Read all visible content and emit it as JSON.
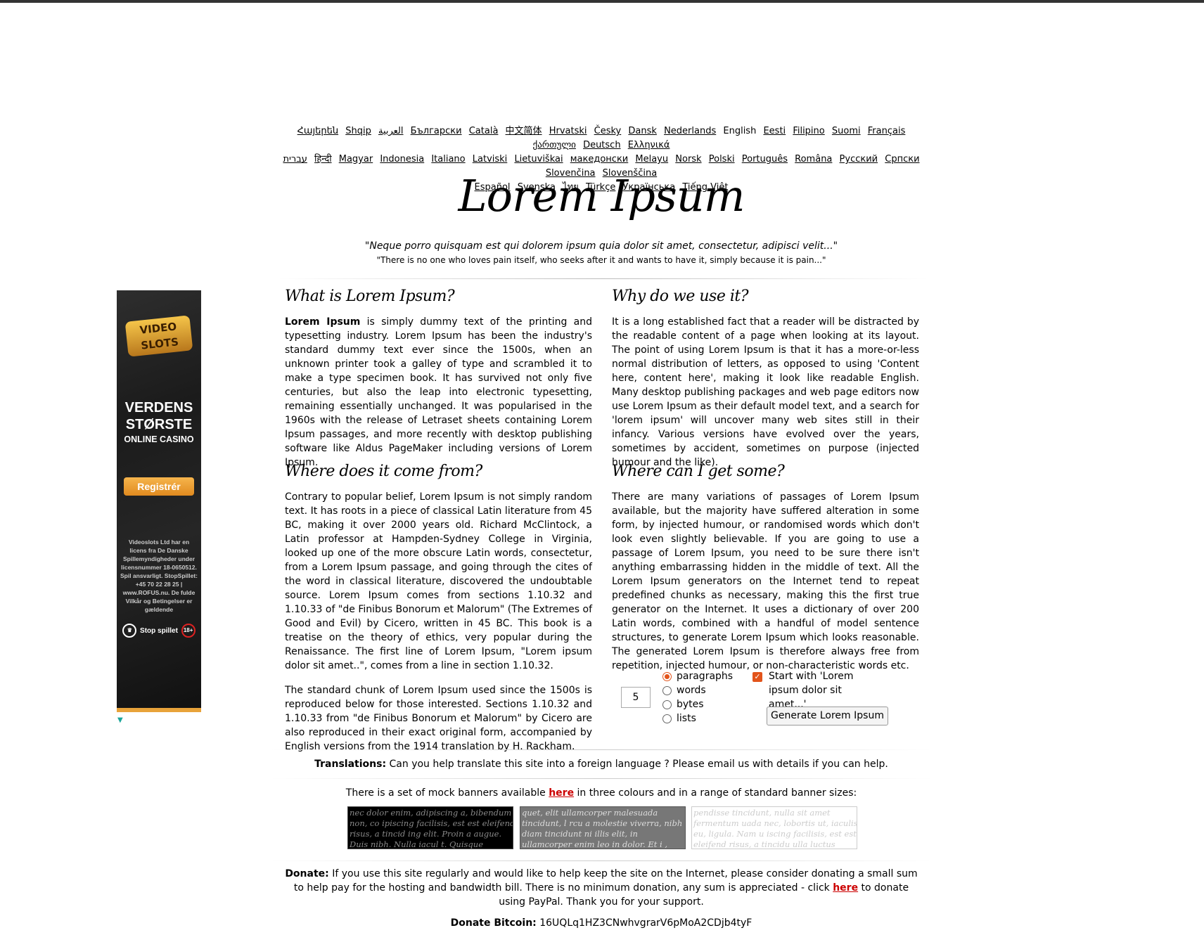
{
  "languages": {
    "row1": [
      "Հայերեն",
      "Shqip",
      "العربية",
      "Български",
      "Català",
      "中文简体",
      "Hrvatski",
      "Česky",
      "Dansk",
      "Nederlands",
      "English",
      "Eesti",
      "Filipino",
      "Suomi",
      "Français",
      "ქართული",
      "Deutsch",
      "Ελληνικά"
    ],
    "row2": [
      "עברית",
      "हिन्दी",
      "Magyar",
      "Indonesia",
      "Italiano",
      "Latviski",
      "Lietuviškai",
      "македонски",
      "Melayu",
      "Norsk",
      "Polski",
      "Português",
      "Româna",
      "Русский",
      "Српски",
      "Slovenčina",
      "Slovenščina"
    ],
    "row3": [
      "Español",
      "Svenska",
      "ไทย",
      "Türkçe",
      "Українська",
      "Tiếng Việt"
    ],
    "current": "English"
  },
  "header": {
    "title": "Lorem Ipsum",
    "quote_latin": "\"Neque porro quisquam est qui dolorem ipsum quia dolor sit amet, consectetur, adipisci velit...\"",
    "quote_english": "\"There is no one who loves pain itself, who seeks after it and wants to have it, simply because it is pain...\""
  },
  "sections": {
    "what": {
      "heading": "What is Lorem Ipsum?",
      "bold": "Lorem Ipsum",
      "text": " is simply dummy text of the printing and typesetting industry. Lorem Ipsum has been the industry's standard dummy text ever since the 1500s, when an unknown printer took a galley of type and scrambled it to make a type specimen book. It has survived not only five centuries, but also the leap into electronic typesetting, remaining essentially unchanged. It was popularised in the 1960s with the release of Letraset sheets containing Lorem Ipsum passages, and more recently with desktop publishing software like Aldus PageMaker including versions of Lorem Ipsum."
    },
    "why": {
      "heading": "Why do we use it?",
      "text": "It is a long established fact that a reader will be distracted by the readable content of a page when looking at its layout. The point of using Lorem Ipsum is that it has a more-or-less normal distribution of letters, as opposed to using 'Content here, content here', making it look like readable English. Many desktop publishing packages and web page editors now use Lorem Ipsum as their default model text, and a search for 'lorem ipsum' will uncover many web sites still in their infancy. Various versions have evolved over the years, sometimes by accident, sometimes on purpose (injected humour and the like)."
    },
    "where_from": {
      "heading": "Where does it come from?",
      "text1": "Contrary to popular belief, Lorem Ipsum is not simply random text. It has roots in a piece of classical Latin literature from 45 BC, making it over 2000 years old. Richard McClintock, a Latin professor at Hampden-Sydney College in Virginia, looked up one of the more obscure Latin words, consectetur, from a Lorem Ipsum passage, and going through the cites of the word in classical literature, discovered the undoubtable source. Lorem Ipsum comes from sections 1.10.32 and 1.10.33 of \"de Finibus Bonorum et Malorum\" (The Extremes of Good and Evil) by Cicero, written in 45 BC. This book is a treatise on the theory of ethics, very popular during the Renaissance. The first line of Lorem Ipsum, \"Lorem ipsum dolor sit amet..\", comes from a line in section 1.10.32.",
      "text2": "The standard chunk of Lorem Ipsum used since the 1500s is reproduced below for those interested. Sections 1.10.32 and 1.10.33 from \"de Finibus Bonorum et Malorum\" by Cicero are also reproduced in their exact original form, accompanied by English versions from the 1914 translation by H. Rackham."
    },
    "where_get": {
      "heading": "Where can I get some?",
      "text": "There are many variations of passages of Lorem Ipsum available, but the majority have suffered alteration in some form, by injected humour, or randomised words which don't look even slightly believable. If you are going to use a passage of Lorem Ipsum, you need to be sure there isn't anything embarrassing hidden in the middle of text. All the Lorem Ipsum generators on the Internet tend to repeat predefined chunks as necessary, making this the first true generator on the Internet. It uses a dictionary of over 200 Latin words, combined with a handful of model sentence structures, to generate Lorem Ipsum which looks reasonable. The generated Lorem Ipsum is therefore always free from repetition, injected humour, or non-characteristic words etc."
    }
  },
  "generator": {
    "amount": "5",
    "options": [
      "paragraphs",
      "words",
      "bytes",
      "lists"
    ],
    "selected": "paragraphs",
    "start_with_label": "Start with 'Lorem ipsum dolor sit amet...'",
    "start_with_checked": true,
    "button_label": "Generate Lorem Ipsum"
  },
  "footer": {
    "translations_bold": "Translations:",
    "translations_text": " Can you help translate this site into a foreign language ? Please email us with details if you can help.",
    "banners_pre": "There is a set of mock banners available ",
    "banners_link": "here",
    "banners_post": " in three colours and in a range of standard banner sizes:",
    "banner_text": "nec dolor enim, adipiscing a, bibendum non, co ipiscing facilisis, est est eleifend risus, a tincid ing elit. Proin a augue. Duis nibh. Nulla iacul t. Quisque pharetra consectetuer ipsum. Sed e",
    "banner2_text": "quet, elit ullamcorper malesuada tincidunt, l rcu a molestie viverra, nibh diam tincidunt ni illis elit, in ullamcorper enim leo in dolor. Et i , nunc. Donec enim. Proin iaculis pulvinar nib",
    "banner3_text": "pendisse tincidunt, nulla sit amet fermentum uada nec, lobortis ut, iaculis eu, ligula. Nam u iscing facilisis, est est eleifend risus, a tincidu ulla luctus dignissim. Proin leo massa, comm",
    "donate_bold": "Donate:",
    "donate_pre": " If you use this site regularly and would like to help keep the site on the Internet, please consider donating a small sum to help pay for the hosting and bandwidth bill. There is no minimum donation, any sum is appreciated - click ",
    "donate_link": "here",
    "donate_post": " to donate using PayPal. Thank you for your support.",
    "bitcoin_bold": "Donate Bitcoin:",
    "bitcoin_address": " 16UQLq1HZ3CNwhvgrarV6pMoA2CDjb4tyF"
  },
  "ad": {
    "logo": "VIDEO SLOTS",
    "headline1": "VERDENS",
    "headline2": "STØRSTE",
    "headline3": "ONLINE CASINO",
    "button": "Registrér",
    "fine_print": "Videoslots Ltd har en licens fra De Danske Spillemyndigheder under licensnummer 18-0650512. Spil ansvarligt. StopSpillet: +45 70 22 28 25 | www.ROFUS.nu. De fulde Vilkår og Betingelser er gældende",
    "stop_label": "Stop spillet",
    "age_label": "18+"
  },
  "colors": {
    "accent": "#e2541b",
    "link_red": "#cc0000",
    "ad_gold": "#e8a33a"
  }
}
